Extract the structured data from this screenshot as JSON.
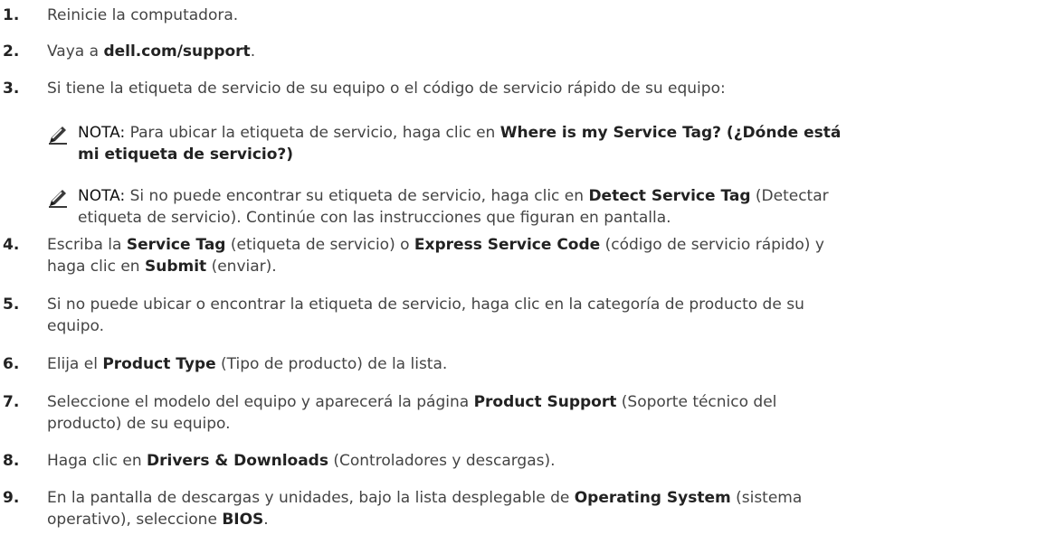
{
  "steps": [
    {
      "num": "1.",
      "parts": [
        {
          "t": "Reinicie la computadora.",
          "b": false
        }
      ]
    },
    {
      "num": "2.",
      "parts": [
        {
          "t": "Vaya a ",
          "b": false
        },
        {
          "t": "dell.com/support",
          "b": true
        },
        {
          "t": ".",
          "b": false
        }
      ]
    },
    {
      "num": "3.",
      "parts": [
        {
          "t": "Si tiene la etiqueta de servicio de su equipo o el código de servicio rápido de su equipo:",
          "b": false
        }
      ]
    },
    {
      "num": "4.",
      "parts": [
        {
          "t": "Escriba la ",
          "b": false
        },
        {
          "t": "Service Tag",
          "b": true
        },
        {
          "t": " (etiqueta de servicio) o ",
          "b": false
        },
        {
          "t": "Express Service Code",
          "b": true
        },
        {
          "t": " (código de servicio rápido) y",
          "b": false
        }
      ],
      "line2": [
        {
          "t": "haga clic en ",
          "b": false
        },
        {
          "t": "Submit",
          "b": true
        },
        {
          "t": " (enviar).",
          "b": false
        }
      ]
    },
    {
      "num": "5.",
      "parts": [
        {
          "t": "Si no puede ubicar o encontrar la etiqueta de servicio, haga clic en la categoría de producto de su",
          "b": false
        }
      ],
      "line2": [
        {
          "t": "equipo.",
          "b": false
        }
      ]
    },
    {
      "num": "6.",
      "parts": [
        {
          "t": "Elija el ",
          "b": false
        },
        {
          "t": "Product Type",
          "b": true
        },
        {
          "t": " (Tipo de producto) de la lista.",
          "b": false
        }
      ]
    },
    {
      "num": "7.",
      "parts": [
        {
          "t": "Seleccione el modelo del equipo y aparecerá la página ",
          "b": false
        },
        {
          "t": "Product Support",
          "b": true
        },
        {
          "t": " (Soporte técnico del",
          "b": false
        }
      ],
      "line2": [
        {
          "t": "producto) de su equipo.",
          "b": false
        }
      ]
    },
    {
      "num": "8.",
      "parts": [
        {
          "t": "Haga clic en ",
          "b": false
        },
        {
          "t": "Drivers & Downloads",
          "b": true
        },
        {
          "t": " (Controladores y descargas).",
          "b": false
        }
      ]
    },
    {
      "num": "9.",
      "parts": [
        {
          "t": "En la pantalla de descargas y unidades, bajo la lista desplegable de ",
          "b": false
        },
        {
          "t": "Operating System",
          "b": true
        },
        {
          "t": " (sistema",
          "b": false
        }
      ],
      "line2": [
        {
          "t": "operativo), seleccione ",
          "b": false
        },
        {
          "t": "BIOS",
          "b": true
        },
        {
          "t": ".",
          "b": false
        }
      ]
    }
  ],
  "notes": [
    {
      "icon": "pencil-note-icon",
      "label": "NOTA:",
      "line1": [
        {
          "t": " Para ubicar la etiqueta de servicio, haga clic en ",
          "b": false
        },
        {
          "t": "Where is my Service Tag? (¿Dónde está",
          "b": true
        }
      ],
      "line2": [
        {
          "t": "mi etiqueta de servicio?)",
          "b": true
        }
      ]
    },
    {
      "icon": "pencil-note-icon",
      "label": "NOTA:",
      "line1": [
        {
          "t": " Si no puede encontrar su etiqueta de servicio, haga clic en ",
          "b": false
        },
        {
          "t": "Detect Service Tag",
          "b": true
        },
        {
          "t": " (Detectar",
          "b": false
        }
      ],
      "line2": [
        {
          "t": "etiqueta de servicio). Continúe con las instrucciones que figuran en pantalla.",
          "b": false
        }
      ]
    }
  ]
}
